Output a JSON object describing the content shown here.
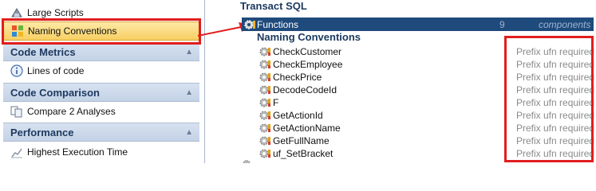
{
  "sidebar": {
    "items_top": [
      {
        "label": "Large Scripts",
        "icon": "scripts-icon"
      },
      {
        "label": "Naming Conventions",
        "icon": "naming-conventions-icon",
        "selected": true
      }
    ],
    "sections": [
      {
        "title": "Code Metrics",
        "items": [
          {
            "label": "Lines of code",
            "icon": "info-icon"
          }
        ]
      },
      {
        "title": "Code Comparison",
        "items": [
          {
            "label": "Compare 2 Analyses",
            "icon": "compare-icon"
          }
        ]
      },
      {
        "title": "Performance",
        "items": [
          {
            "label": "Highest Execution Time",
            "icon": "chart-icon"
          }
        ]
      }
    ]
  },
  "results": {
    "scope_title": "Transact SQL",
    "group": {
      "name": "Functions",
      "count": "9",
      "unit": "components"
    },
    "rule_title": "Naming Conventions",
    "rows": [
      {
        "name": "CheckCustomer",
        "message": "Prefix ufn required"
      },
      {
        "name": "CheckEmployee",
        "message": "Prefix ufn required"
      },
      {
        "name": "CheckPrice",
        "message": "Prefix ufn required"
      },
      {
        "name": "DecodeCodeId",
        "message": "Prefix ufn required"
      },
      {
        "name": "F",
        "message": "Prefix ufn required"
      },
      {
        "name": "GetActionId",
        "message": "Prefix ufn required"
      },
      {
        "name": "GetActionName",
        "message": "Prefix ufn required"
      },
      {
        "name": "GetFullName",
        "message": "Prefix ufn required"
      },
      {
        "name": "uf_SetBracket",
        "message": "Prefix ufn required"
      }
    ]
  },
  "colors": {
    "selection_fill": "#f8cf62",
    "highlight_red": "#e01e1e",
    "group_row_bg": "#1f4a7c",
    "section_title": "#1e3a60"
  }
}
